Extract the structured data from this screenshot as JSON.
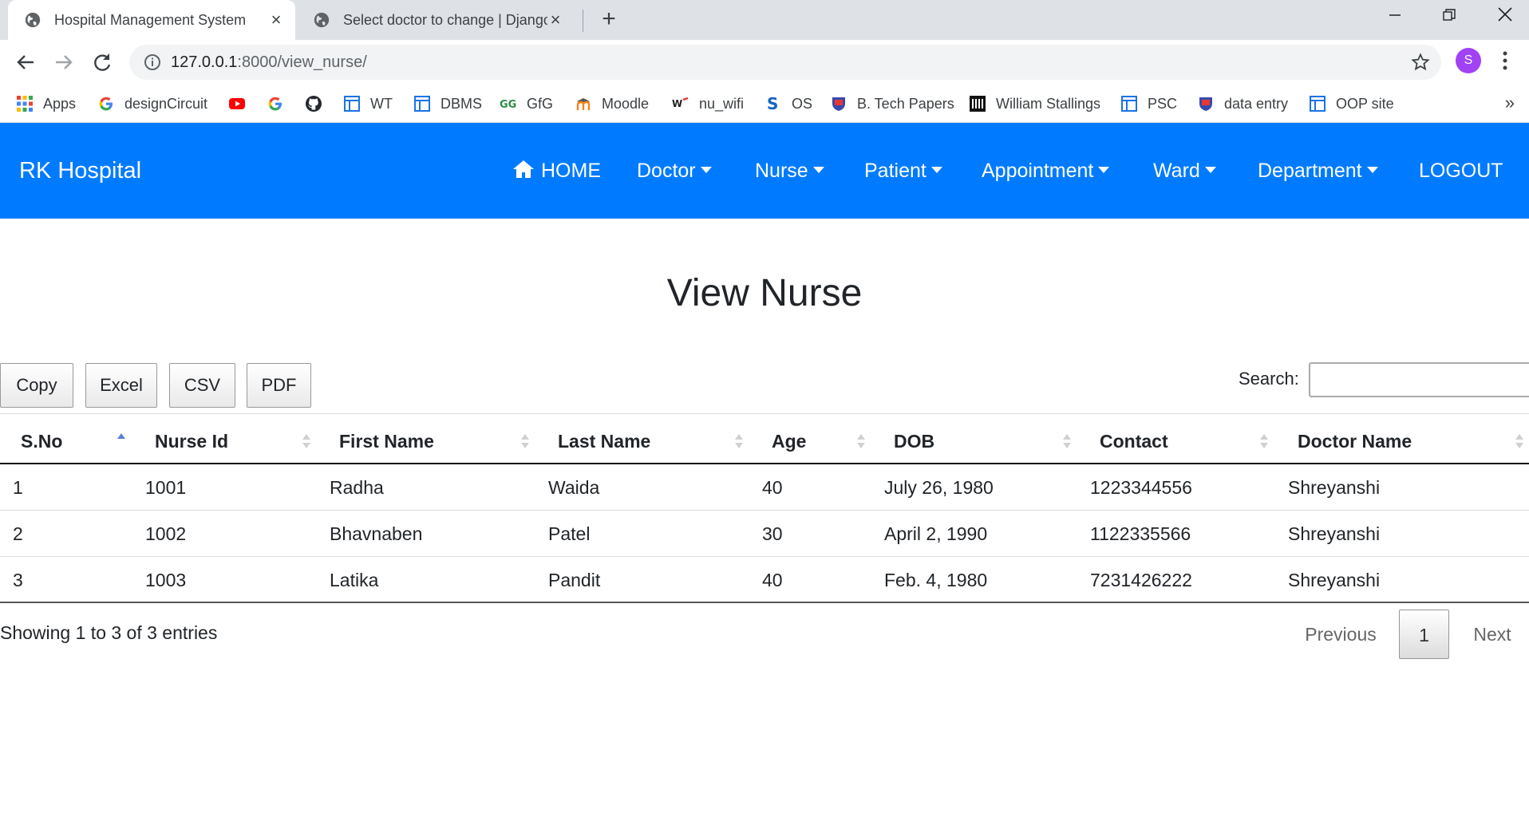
{
  "browser": {
    "tabs": [
      {
        "title": "Hospital Management System"
      },
      {
        "title": "Select doctor to change | Django site admin"
      }
    ],
    "url_host": "127.0.0.1",
    "url_path": ":8000/view_nurse/",
    "profile_initial": "S",
    "bookmarks": [
      {
        "label": "Apps",
        "icon": "apps-grid-icon"
      },
      {
        "label": "designCircuit",
        "icon": "google-icon"
      },
      {
        "label": "",
        "icon": "youtube-icon"
      },
      {
        "label": "",
        "icon": "google-icon"
      },
      {
        "label": "",
        "icon": "github-icon"
      },
      {
        "label": "WT",
        "icon": "page-icon"
      },
      {
        "label": "DBMS",
        "icon": "page-icon"
      },
      {
        "label": "GfG",
        "icon": "gfg-icon"
      },
      {
        "label": "Moodle",
        "icon": "moodle-icon"
      },
      {
        "label": "nu_wifi",
        "icon": "nu-wifi-icon"
      },
      {
        "label": "OS",
        "icon": "os-icon"
      },
      {
        "label": "B. Tech Papers",
        "icon": "shield-icon"
      },
      {
        "label": "William Stallings",
        "icon": "building-icon"
      },
      {
        "label": "PSC",
        "icon": "page-icon"
      },
      {
        "label": "data entry",
        "icon": "shield-icon"
      },
      {
        "label": "OOP site",
        "icon": "page-icon"
      }
    ],
    "bookmarks_more": "»"
  },
  "navbar": {
    "brand": "RK Hospital",
    "items": [
      {
        "label": "HOME",
        "dropdown": false
      },
      {
        "label": "Doctor",
        "dropdown": true
      },
      {
        "label": "Nurse",
        "dropdown": true
      },
      {
        "label": "Patient",
        "dropdown": true
      },
      {
        "label": "Appointment",
        "dropdown": true
      },
      {
        "label": "Ward",
        "dropdown": true
      },
      {
        "label": "Department",
        "dropdown": true
      },
      {
        "label": "LOGOUT",
        "dropdown": false
      }
    ],
    "color": "#007bff"
  },
  "page": {
    "title": "View Nurse",
    "export_buttons": [
      "Copy",
      "Excel",
      "CSV",
      "PDF"
    ],
    "search_label": "Search:",
    "search_value": ""
  },
  "table": {
    "columns": [
      "S.No",
      "Nurse Id",
      "First Name",
      "Last Name",
      "Age",
      "DOB",
      "Contact",
      "Doctor Name"
    ],
    "rows": [
      [
        "1",
        "1001",
        "Radha",
        "Waida",
        "40",
        "July 26, 1980",
        "1223344556",
        "Shreyanshi"
      ],
      [
        "2",
        "1002",
        "Bhavnaben",
        "Patel",
        "30",
        "April 2, 1990",
        "1122335566",
        "Shreyanshi"
      ],
      [
        "3",
        "1003",
        "Latika",
        "Pandit",
        "40",
        "Feb. 4, 1980",
        "7231426222",
        "Shreyanshi"
      ]
    ],
    "sorted_column": "S.No",
    "info": "Showing 1 to 3 of 3 entries",
    "pagination": {
      "previous": "Previous",
      "current": "1",
      "next": "Next"
    }
  }
}
